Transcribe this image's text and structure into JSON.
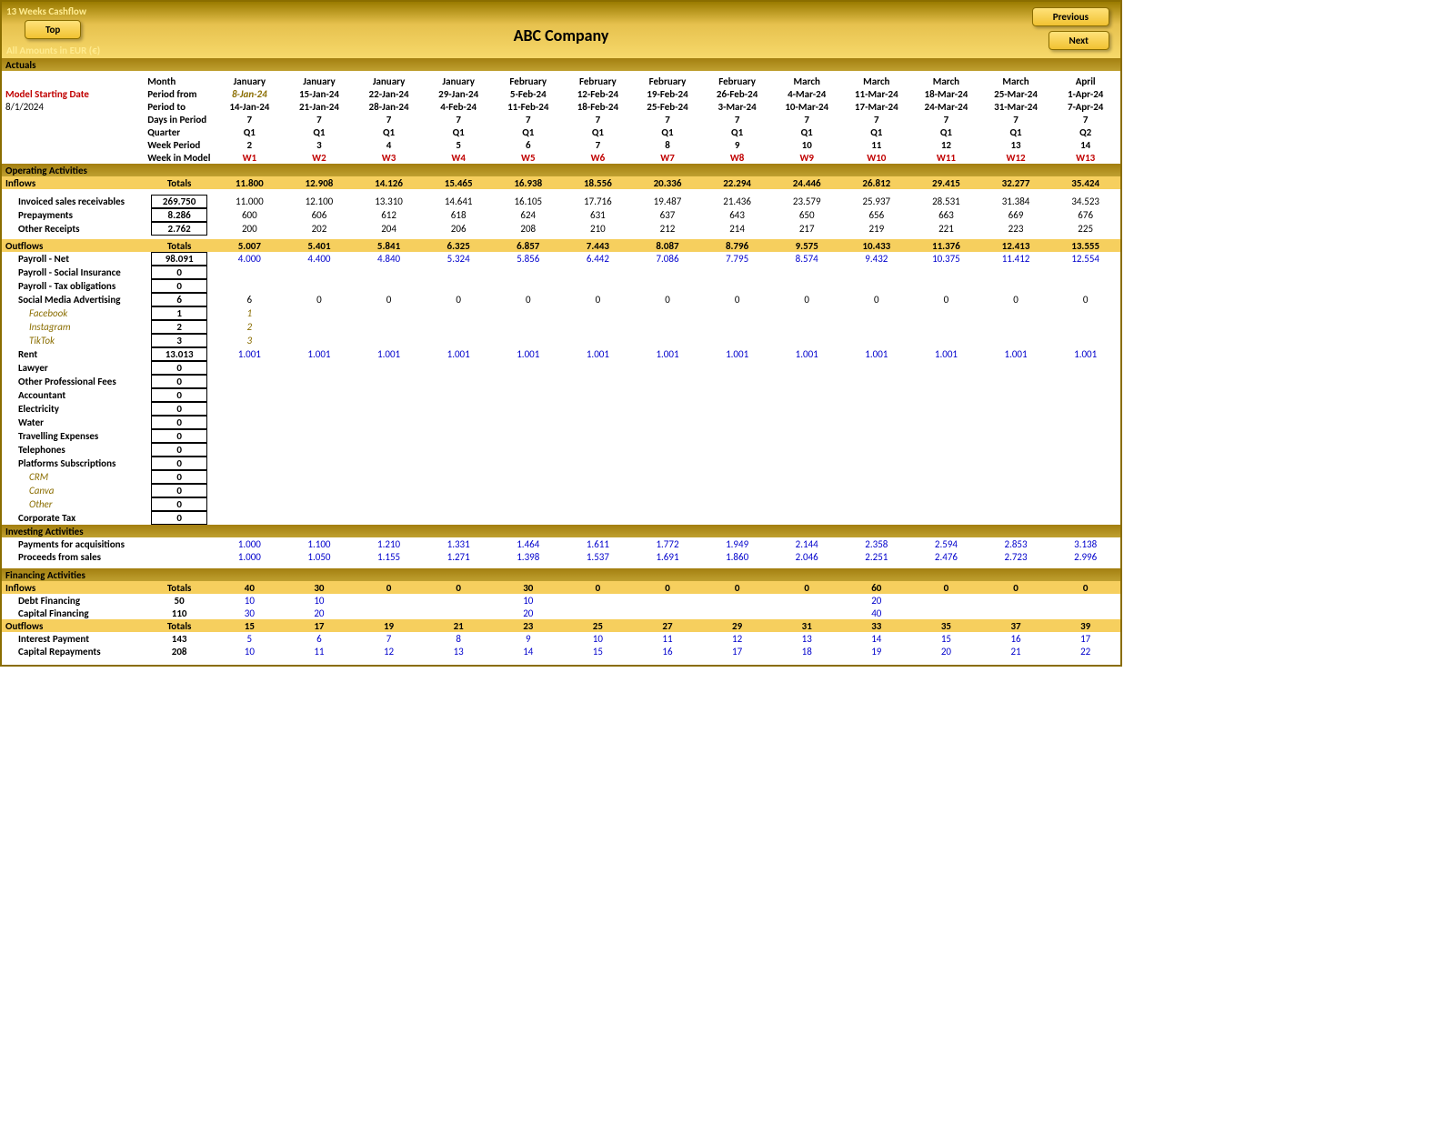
{
  "header": {
    "sheet_name": "13 Weeks Cashflow",
    "company": "ABC Company",
    "currency_note": "All Amounts in  EUR (€)",
    "btn_top": "Top",
    "btn_prev": "Previous",
    "btn_next": "Next",
    "actuals": "Actuals"
  },
  "model": {
    "starting_label": "Model Starting Date",
    "starting_date": "8/1/2024",
    "row_labels": [
      "Month",
      "Period from",
      "Period to",
      "Days in Period",
      "Quarter",
      "Week Period",
      "Week in Model"
    ],
    "months": [
      "January",
      "January",
      "January",
      "January",
      "February",
      "February",
      "February",
      "February",
      "March",
      "March",
      "March",
      "March",
      "April"
    ],
    "period_from": [
      "8-Jan-24",
      "15-Jan-24",
      "22-Jan-24",
      "29-Jan-24",
      "5-Feb-24",
      "12-Feb-24",
      "19-Feb-24",
      "26-Feb-24",
      "4-Mar-24",
      "11-Mar-24",
      "18-Mar-24",
      "25-Mar-24",
      "1-Apr-24"
    ],
    "period_to": [
      "14-Jan-24",
      "21-Jan-24",
      "28-Jan-24",
      "4-Feb-24",
      "11-Feb-24",
      "18-Feb-24",
      "25-Feb-24",
      "3-Mar-24",
      "10-Mar-24",
      "17-Mar-24",
      "24-Mar-24",
      "31-Mar-24",
      "7-Apr-24"
    ],
    "days": [
      "7",
      "7",
      "7",
      "7",
      "7",
      "7",
      "7",
      "7",
      "7",
      "7",
      "7",
      "7",
      "7"
    ],
    "quarter": [
      "Q1",
      "Q1",
      "Q1",
      "Q1",
      "Q1",
      "Q1",
      "Q1",
      "Q1",
      "Q1",
      "Q1",
      "Q1",
      "Q1",
      "Q2"
    ],
    "week_period": [
      "2",
      "3",
      "4",
      "5",
      "6",
      "7",
      "8",
      "9",
      "10",
      "11",
      "12",
      "13",
      "14"
    ],
    "week_model": [
      "W1",
      "W2",
      "W3",
      "W4",
      "W5",
      "W6",
      "W7",
      "W8",
      "W9",
      "W10",
      "W11",
      "W12",
      "W13"
    ]
  },
  "sections": {
    "operating": "Operating Activities",
    "investing": "Investing Activities",
    "financing": "Financing Activities",
    "inflows": "Inflows",
    "outflows": "Outflows",
    "totals": "Totals"
  },
  "op_inflows": {
    "totals": [
      "11.800",
      "12.908",
      "14.126",
      "15.465",
      "16.938",
      "18.556",
      "20.336",
      "22.294",
      "24.446",
      "26.812",
      "29.415",
      "32.277",
      "35.424"
    ],
    "rows": [
      {
        "label": "Invoiced sales receivables",
        "total": "269.750",
        "v": [
          "11.000",
          "12.100",
          "13.310",
          "14.641",
          "16.105",
          "17.716",
          "19.487",
          "21.436",
          "23.579",
          "25.937",
          "28.531",
          "31.384",
          "34.523"
        ]
      },
      {
        "label": "Prepayments",
        "total": "8.286",
        "v": [
          "600",
          "606",
          "612",
          "618",
          "624",
          "631",
          "637",
          "643",
          "650",
          "656",
          "663",
          "669",
          "676"
        ]
      },
      {
        "label": "Other Receipts",
        "total": "2.762",
        "v": [
          "200",
          "202",
          "204",
          "206",
          "208",
          "210",
          "212",
          "214",
          "217",
          "219",
          "221",
          "223",
          "225"
        ]
      }
    ]
  },
  "op_outflows": {
    "totals": [
      "5.007",
      "5.401",
      "5.841",
      "6.325",
      "6.857",
      "7.443",
      "8.087",
      "8.796",
      "9.575",
      "10.433",
      "11.376",
      "12.413",
      "13.555"
    ],
    "rows": [
      {
        "label": "Payroll - Net",
        "total": "98.091",
        "blue": true,
        "v": [
          "4.000",
          "4.400",
          "4.840",
          "5.324",
          "5.856",
          "6.442",
          "7.086",
          "7.795",
          "8.574",
          "9.432",
          "10.375",
          "11.412",
          "12.554"
        ]
      },
      {
        "label": "Payroll - Social Insurance",
        "total": "0",
        "v": []
      },
      {
        "label": "Payroll - Tax obligations",
        "total": "0",
        "v": []
      },
      {
        "label": "Social Media Advertising",
        "total": "6",
        "v": [
          "6",
          "0",
          "0",
          "0",
          "0",
          "0",
          "0",
          "0",
          "0",
          "0",
          "0",
          "0",
          "0"
        ]
      },
      {
        "label": "Facebook",
        "sub": true,
        "total": "1",
        "blue": true,
        "v": [
          "1"
        ]
      },
      {
        "label": "Instagram",
        "sub": true,
        "total": "2",
        "blue": true,
        "v": [
          "2"
        ]
      },
      {
        "label": "TikTok",
        "sub": true,
        "total": "3",
        "blue": true,
        "v": [
          "3"
        ]
      },
      {
        "label": "Rent",
        "total": "13.013",
        "blue": true,
        "v": [
          "1.001",
          "1.001",
          "1.001",
          "1.001",
          "1.001",
          "1.001",
          "1.001",
          "1.001",
          "1.001",
          "1.001",
          "1.001",
          "1.001",
          "1.001"
        ]
      },
      {
        "label": "Lawyer",
        "total": "0",
        "v": []
      },
      {
        "label": "Other Professional Fees",
        "total": "0",
        "v": []
      },
      {
        "label": "Accountant",
        "total": "0",
        "v": []
      },
      {
        "label": "Electricity",
        "total": "0",
        "v": []
      },
      {
        "label": "Water",
        "total": "0",
        "v": []
      },
      {
        "label": "Travelling Expenses",
        "total": "0",
        "v": []
      },
      {
        "label": "Telephones",
        "total": "0",
        "v": []
      },
      {
        "label": "Platforms Subscriptions",
        "total": "0",
        "v": []
      },
      {
        "label": "CRM",
        "sub": true,
        "total": "0",
        "v": []
      },
      {
        "label": "Canva",
        "sub": true,
        "total": "0",
        "v": []
      },
      {
        "label": "Other",
        "sub": true,
        "total": "0",
        "v": []
      },
      {
        "label": "Corporate Tax",
        "total": "0",
        "v": []
      }
    ]
  },
  "investing": {
    "rows": [
      {
        "label": "Payments for acquisitions",
        "blue": true,
        "v": [
          "1.000",
          "1.100",
          "1.210",
          "1.331",
          "1.464",
          "1.611",
          "1.772",
          "1.949",
          "2.144",
          "2.358",
          "2.594",
          "2.853",
          "3.138"
        ]
      },
      {
        "label": "Proceeds from sales",
        "blue": true,
        "v": [
          "1.000",
          "1.050",
          "1.155",
          "1.271",
          "1.398",
          "1.537",
          "1.691",
          "1.860",
          "2.046",
          "2.251",
          "2.476",
          "2.723",
          "2.996"
        ]
      }
    ]
  },
  "fin_inflows": {
    "totals": [
      "40",
      "30",
      "0",
      "0",
      "30",
      "0",
      "0",
      "0",
      "0",
      "60",
      "0",
      "0",
      "0"
    ],
    "rows": [
      {
        "label": "Debt Financing",
        "total": "50",
        "blue": true,
        "v": [
          "10",
          "10",
          "",
          "",
          "10",
          "",
          "",
          "",
          "",
          "20",
          "",
          "",
          ""
        ]
      },
      {
        "label": "Capital Financing",
        "total": "110",
        "blue": true,
        "v": [
          "30",
          "20",
          "",
          "",
          "20",
          "",
          "",
          "",
          "",
          "40",
          "",
          "",
          ""
        ]
      }
    ]
  },
  "fin_outflows": {
    "totals": [
      "15",
      "17",
      "19",
      "21",
      "23",
      "25",
      "27",
      "29",
      "31",
      "33",
      "35",
      "37",
      "39"
    ],
    "rows": [
      {
        "label": "Interest Payment",
        "total": "143",
        "blue": true,
        "v": [
          "5",
          "6",
          "7",
          "8",
          "9",
          "10",
          "11",
          "12",
          "13",
          "14",
          "15",
          "16",
          "17"
        ]
      },
      {
        "label": "Capital Repayments",
        "total": "208",
        "blue": true,
        "v": [
          "10",
          "11",
          "12",
          "13",
          "14",
          "15",
          "16",
          "17",
          "18",
          "19",
          "20",
          "21",
          "22"
        ]
      }
    ]
  }
}
